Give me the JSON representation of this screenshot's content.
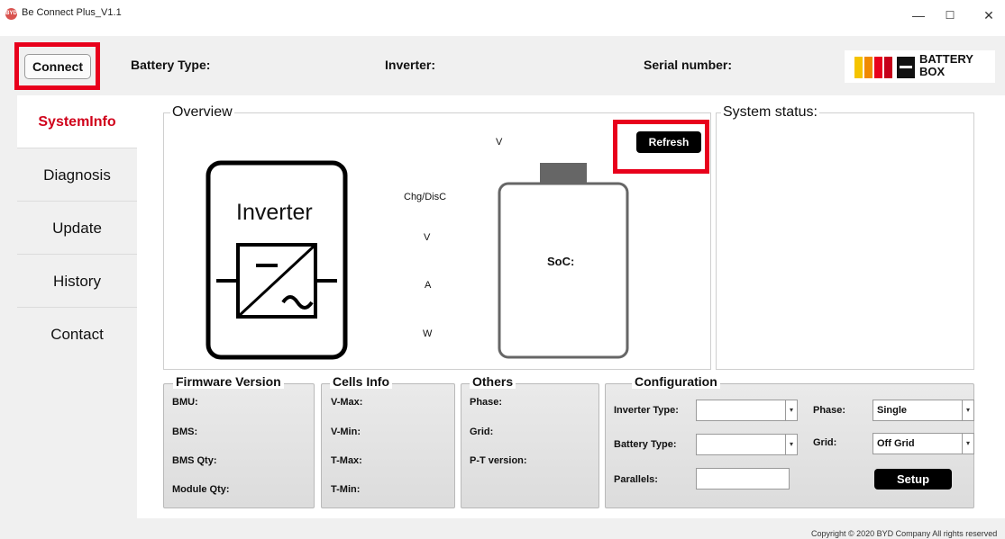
{
  "window": {
    "title": "Be Connect Plus_V1.1",
    "app_icon_text": "BYD"
  },
  "window_controls": {
    "minimize": "—",
    "maximize": "☐",
    "close": "✕"
  },
  "header": {
    "connect_label": "Connect",
    "battery_type_label": "Battery Type:",
    "inverter_label": "Inverter:",
    "serial_number_label": "Serial number:",
    "logo_text_1": "BATTERY",
    "logo_text_2": "BOX",
    "logo_colors": [
      "#f5c400",
      "#f08a00",
      "#e8001c",
      "#c6001a"
    ]
  },
  "sidebar": {
    "items": [
      {
        "label": "SystemInfo",
        "active": true
      },
      {
        "label": "Diagnosis",
        "active": false
      },
      {
        "label": "Update",
        "active": false
      },
      {
        "label": "History",
        "active": false
      },
      {
        "label": "Contact",
        "active": false
      }
    ]
  },
  "overview": {
    "title": "Overview",
    "inverter_label": "Inverter",
    "battery_voltage_label": "V",
    "chg_disc_label": "Chg/DisC",
    "volt_label": "V",
    "amp_label": "A",
    "watt_label": "W",
    "soc_label": "SoC:",
    "refresh_label": "Refresh"
  },
  "system_status": {
    "title": "System status:"
  },
  "firmware": {
    "title": "Firmware Version",
    "items": [
      "BMU:",
      "BMS:",
      "BMS Qty:",
      "Module Qty:"
    ]
  },
  "cells": {
    "title": "Cells Info",
    "items": [
      "V-Max:",
      "V-Min:",
      "T-Max:",
      "T-Min:"
    ]
  },
  "others": {
    "title": "Others",
    "items": [
      "Phase:",
      "Grid:",
      "P-T version:"
    ]
  },
  "configuration": {
    "title": "Configuration",
    "inverter_type_label": "Inverter Type:",
    "inverter_type_value": "",
    "battery_type_label": "Battery Type:",
    "battery_type_value": "",
    "parallels_label": "Parallels:",
    "parallels_value": "",
    "phase_label": "Phase:",
    "phase_value": "Single",
    "grid_label": "Grid:",
    "grid_value": "Off Grid",
    "setup_label": "Setup"
  },
  "footer": {
    "copyright": "Copyright © 2020 BYD Company All rights reserved"
  },
  "colors": {
    "accent_red": "#e8001c",
    "active_tab_text": "#d0021b"
  }
}
